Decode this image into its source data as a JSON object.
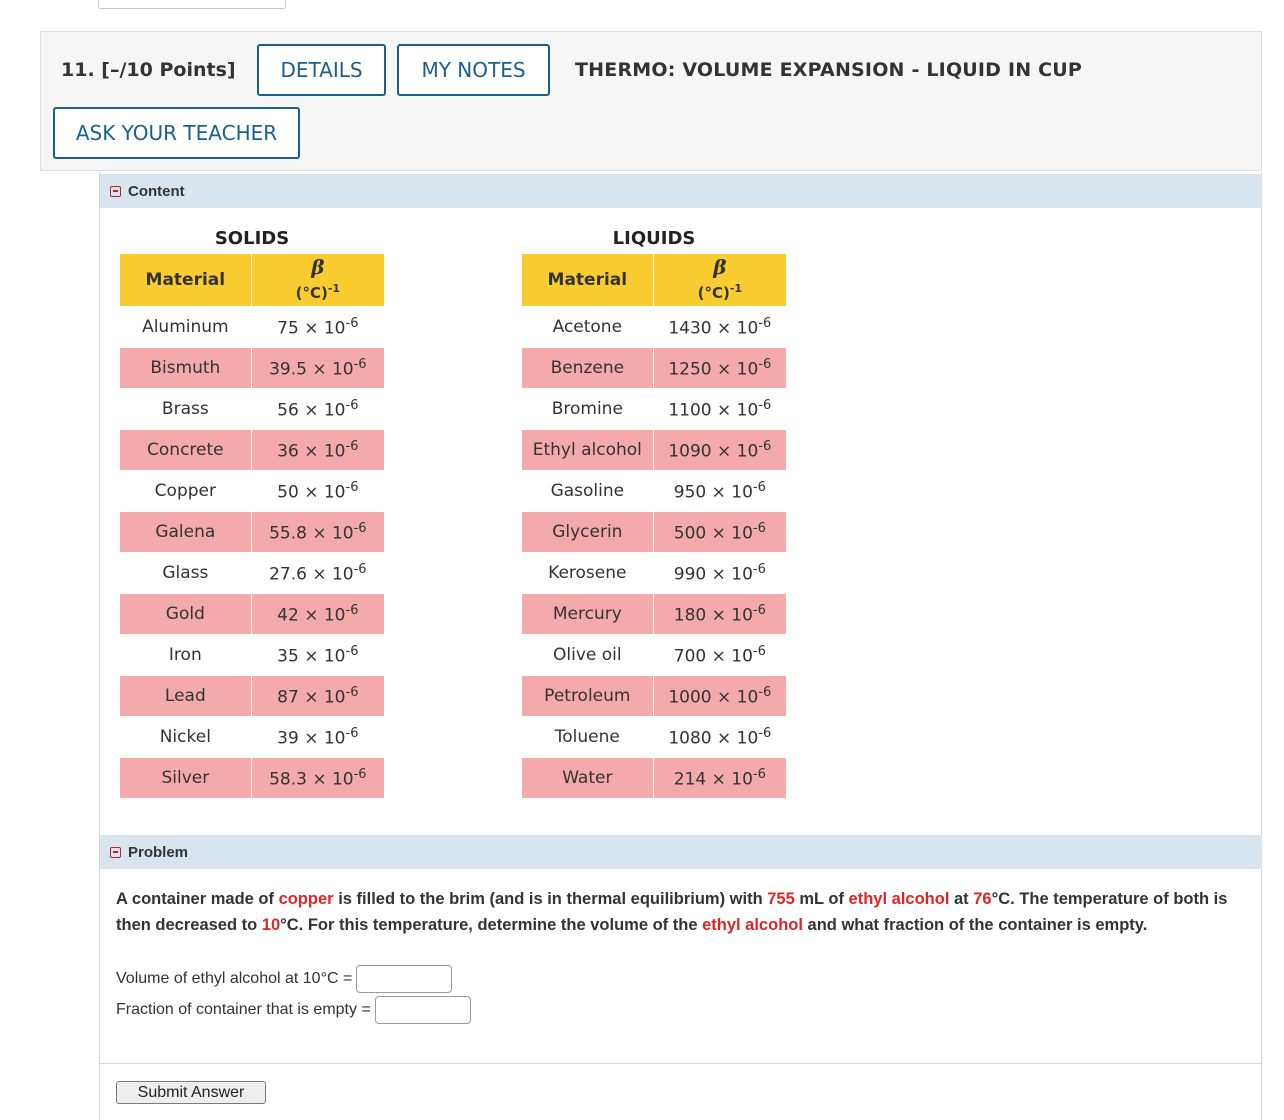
{
  "question": {
    "number": "11.",
    "points": "[–/10 Points]",
    "details_label": "DETAILS",
    "my_notes_label": "MY NOTES",
    "title": "THERMO: VOLUME EXPANSION - LIQUID IN CUP",
    "ask_teacher_label": "ASK YOUR TEACHER"
  },
  "content_section": {
    "label": "Content"
  },
  "solids": {
    "caption": "SOLIDS",
    "col_material": "Material",
    "col_beta": "β",
    "col_unit": "(°C)",
    "col_unit_exp": "-1",
    "rows": [
      {
        "material": "Aluminum",
        "mantissa": "75 × 10",
        "exp": "-6"
      },
      {
        "material": "Bismuth",
        "mantissa": "39.5 × 10",
        "exp": "-6"
      },
      {
        "material": "Brass",
        "mantissa": "56 × 10",
        "exp": "-6"
      },
      {
        "material": "Concrete",
        "mantissa": "36 × 10",
        "exp": "-6"
      },
      {
        "material": "Copper",
        "mantissa": "50 × 10",
        "exp": "-6"
      },
      {
        "material": "Galena",
        "mantissa": "55.8 × 10",
        "exp": "-6"
      },
      {
        "material": "Glass",
        "mantissa": "27.6 × 10",
        "exp": "-6"
      },
      {
        "material": "Gold",
        "mantissa": "42 × 10",
        "exp": "-6"
      },
      {
        "material": "Iron",
        "mantissa": "35 × 10",
        "exp": "-6"
      },
      {
        "material": "Lead",
        "mantissa": "87 × 10",
        "exp": "-6"
      },
      {
        "material": "Nickel",
        "mantissa": "39 × 10",
        "exp": "-6"
      },
      {
        "material": "Silver",
        "mantissa": "58.3 × 10",
        "exp": "-6"
      }
    ]
  },
  "liquids": {
    "caption": "LIQUIDS",
    "col_material": "Material",
    "col_beta": "β",
    "col_unit": "(°C)",
    "col_unit_exp": "-1",
    "rows": [
      {
        "material": "Acetone",
        "mantissa": "1430 × 10",
        "exp": "-6"
      },
      {
        "material": "Benzene",
        "mantissa": "1250 × 10",
        "exp": "-6"
      },
      {
        "material": "Bromine",
        "mantissa": "1100 × 10",
        "exp": "-6"
      },
      {
        "material": "Ethyl alcohol",
        "mantissa": "1090 × 10",
        "exp": "-6"
      },
      {
        "material": "Gasoline",
        "mantissa": "950 × 10",
        "exp": "-6"
      },
      {
        "material": "Glycerin",
        "mantissa": "500 × 10",
        "exp": "-6"
      },
      {
        "material": "Kerosene",
        "mantissa": "990 × 10",
        "exp": "-6"
      },
      {
        "material": "Mercury",
        "mantissa": "180 × 10",
        "exp": "-6"
      },
      {
        "material": "Olive oil",
        "mantissa": "700 × 10",
        "exp": "-6"
      },
      {
        "material": "Petroleum",
        "mantissa": "1000 × 10",
        "exp": "-6"
      },
      {
        "material": "Toluene",
        "mantissa": "1080 × 10",
        "exp": "-6"
      },
      {
        "material": "Water",
        "mantissa": "214 × 10",
        "exp": "-6"
      }
    ]
  },
  "problem_section": {
    "label": "Problem"
  },
  "problem": {
    "t1": "A container made of ",
    "h1": "copper",
    "t2": " is filled to the brim (and is in thermal equilibrium) with ",
    "h2": "755",
    "t3": " mL of ",
    "h3": "ethyl alcohol",
    "t4": " at ",
    "h4": "76",
    "t5": "°C. The temperature of both is then decreased to ",
    "h5": "10",
    "t6": "°C. For this temperature, determine the volume of the ",
    "h6": "ethyl alcohol",
    "t7": " and what fraction of the container is empty."
  },
  "answers": {
    "volume_label": "Volume of ethyl alcohol at 10°C =",
    "volume_value": "",
    "fraction_label": "Fraction of container that is empty =",
    "fraction_value": ""
  },
  "submit_label": "Submit Answer",
  "colors": {
    "header_yellow": "#f9cd2f",
    "row_pink": "#f4aaaa",
    "link_blue": "#1b5f8c",
    "highlight_red": "#e22424",
    "section_bar": "#d8e5ee"
  }
}
